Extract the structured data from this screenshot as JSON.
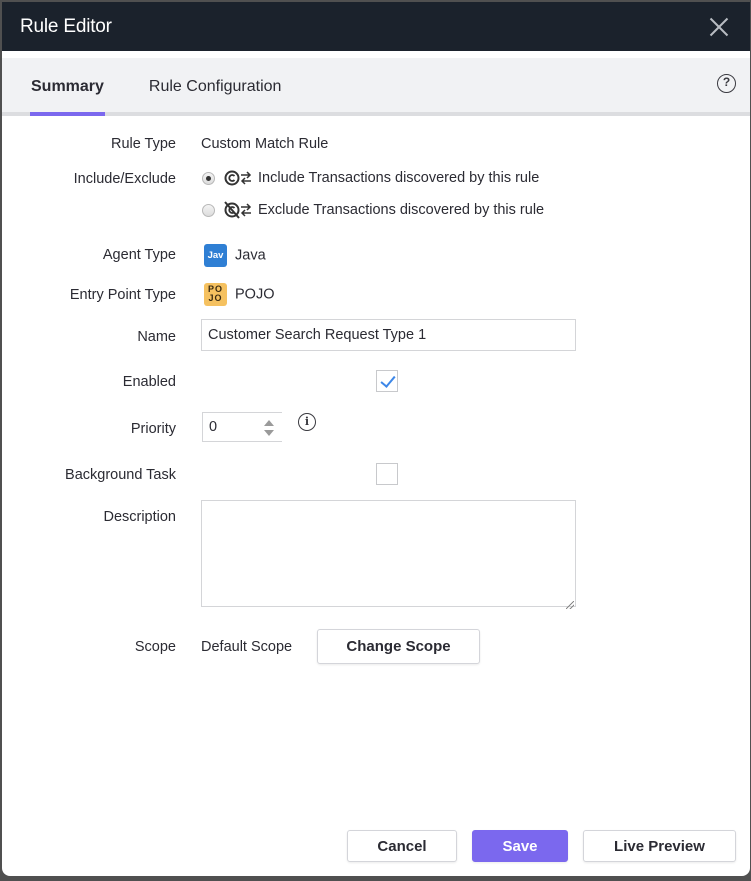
{
  "window": {
    "title": "Rule Editor",
    "close_icon": "close-icon"
  },
  "tabs": [
    {
      "label": "Summary",
      "active": true
    },
    {
      "label": "Rule Configuration",
      "active": false
    }
  ],
  "help_icon": "help-circle-icon",
  "form": {
    "rule_type": {
      "label": "Rule Type",
      "value": "Custom Match Rule"
    },
    "include_exclude": {
      "label": "Include/Exclude",
      "options": [
        {
          "label": "Include Transactions discovered by this rule",
          "icon": "include-transactions-icon",
          "selected": true
        },
        {
          "label": "Exclude Transactions discovered by this rule",
          "icon": "exclude-transactions-icon",
          "selected": false
        }
      ]
    },
    "agent_type": {
      "label": "Agent Type",
      "badge": "Jav",
      "value": "Java",
      "badge_color": "#2f7fd4"
    },
    "entry_point_type": {
      "label": "Entry Point Type",
      "badge_top": "PO",
      "badge_bottom": "JO",
      "value": "POJO",
      "badge_color": "#f5c160"
    },
    "name": {
      "label": "Name",
      "value": "Customer Search Request Type 1"
    },
    "enabled": {
      "label": "Enabled",
      "checked": true
    },
    "priority": {
      "label": "Priority",
      "value": "0"
    },
    "background_task": {
      "label": "Background Task",
      "checked": false
    },
    "description": {
      "label": "Description",
      "value": ""
    },
    "scope": {
      "label": "Scope",
      "value": "Default Scope",
      "button": "Change Scope"
    }
  },
  "footer": {
    "cancel": "Cancel",
    "save": "Save",
    "live_preview": "Live Preview"
  },
  "colors": {
    "accent": "#7b68ee",
    "titlebar": "#1b222c",
    "checkmark": "#3d87e8"
  }
}
